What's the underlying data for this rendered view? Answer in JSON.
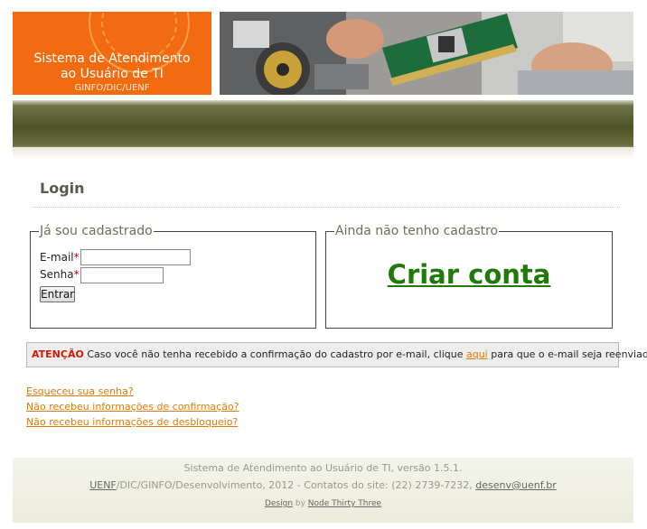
{
  "header": {
    "logo_line1": "Sistema de Atendimento",
    "logo_line2": "ao Usuário de TI",
    "logo_line3": "GINFO/DIC/UENF",
    "photo_alt": "hands holding a computer graphics card above a PC motherboard"
  },
  "login": {
    "title": "Login",
    "registered_legend": "Já sou cadastrado",
    "email_label": "E-mail",
    "password_label": "Senha",
    "required_mark": "*",
    "email_value": "",
    "password_value": "",
    "submit_label": "Entrar",
    "new_legend": "Ainda não tenho cadastro",
    "create_account_label": "Criar conta"
  },
  "notice": {
    "warning": "ATENÇÃO",
    "text_before": " Caso você não tenha recebido a confirmação do cadastro por e-mail, clique ",
    "link": "aqui",
    "text_after": " para que o e-mail seja reenviado."
  },
  "links": {
    "forgot_password": "Esqueceu sua senha?",
    "no_confirmation": "Não recebeu informações de confirmação?",
    "no_unblock": "Não recebeu informações de desbloqueio?"
  },
  "footer": {
    "line1": "Sistema de Atendimento ao Usuário de TI, versão 1.5.1.",
    "uenf": "UENF",
    "line2_middle": "/DIC/GINFO/Desenvolvimento, 2012 - Contatos do site: (22) 2739-7232, ",
    "email": "desenv@uenf.br",
    "design": "Design",
    "by": " by ",
    "node": "Node Thirty Three"
  },
  "colors": {
    "logo_orange": "#f26b11",
    "create_green": "#1f7a07",
    "link_orange": "#e07b00",
    "warning_red": "#d11a00",
    "bar_olive": "#4f5329"
  }
}
